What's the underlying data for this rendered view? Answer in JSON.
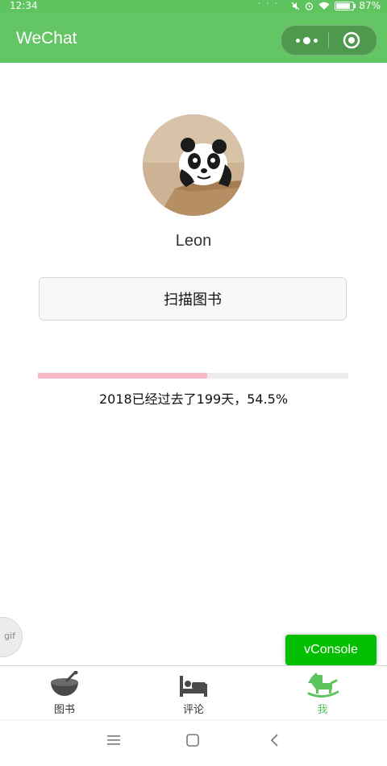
{
  "status_bar": {
    "time": "12:34",
    "notif_dots": "· · ·",
    "battery_pct": "87%",
    "icons": [
      "mute-icon",
      "alarm-icon",
      "wifi-icon",
      "battery-icon"
    ]
  },
  "nav": {
    "title": "WeChat",
    "capsule_icons": [
      "more-dots-icon",
      "close-target-icon"
    ]
  },
  "profile": {
    "username": "Leon",
    "avatar_icon": "panda-avatar"
  },
  "scan_button": {
    "label": "扫描图书"
  },
  "year_progress": {
    "percent": 54.5,
    "text": "2018已经过去了199天，54.5%"
  },
  "float": {
    "gif_label": "gif",
    "vconsole_label": "vConsole"
  },
  "tabbar": {
    "tabs": [
      {
        "label": "图书",
        "icon": "bowl-icon",
        "active": false
      },
      {
        "label": "评论",
        "icon": "bed-icon",
        "active": false
      },
      {
        "label": "我",
        "icon": "rocking-horse-icon",
        "active": true
      }
    ]
  },
  "system_nav": {
    "icons": [
      "menu-icon",
      "home-icon",
      "back-icon"
    ]
  },
  "colors": {
    "accent": "#63c564",
    "progress_fill": "#f6b9c3",
    "vconsole": "#04be02",
    "active_tab": "#5ec45f"
  }
}
